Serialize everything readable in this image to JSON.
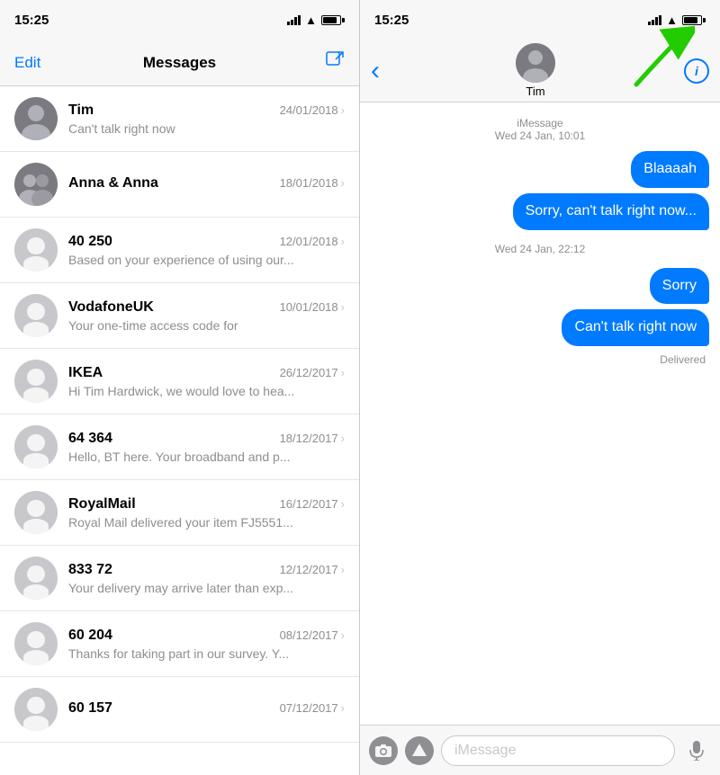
{
  "left": {
    "status_bar": {
      "time": "15:25"
    },
    "nav": {
      "edit": "Edit",
      "title": "Messages",
      "compose_icon": "✏"
    },
    "conversations": [
      {
        "id": 1,
        "name": "Tim",
        "date": "24/01/2018",
        "preview": "Can't talk right now",
        "avatar_type": "tim"
      },
      {
        "id": 2,
        "name": "Anna & Anna",
        "date": "18/01/2018",
        "preview": "...",
        "avatar_type": "group"
      },
      {
        "id": 3,
        "name": "40 250",
        "date": "12/01/2018",
        "preview": "Based on your experience of using our...",
        "avatar_type": "generic"
      },
      {
        "id": 4,
        "name": "VodafoneUK",
        "date": "10/01/2018",
        "preview": "Your one-time access code for",
        "avatar_type": "generic"
      },
      {
        "id": 5,
        "name": "IKEA",
        "date": "26/12/2017",
        "preview": "Hi Tim Hardwick, we would love to hea...",
        "avatar_type": "generic"
      },
      {
        "id": 6,
        "name": "64 364",
        "date": "18/12/2017",
        "preview": "Hello, BT here. Your broadband and p...",
        "avatar_type": "generic"
      },
      {
        "id": 7,
        "name": "RoyalMail",
        "date": "16/12/2017",
        "preview": "Royal Mail delivered your item FJ5551...",
        "avatar_type": "generic"
      },
      {
        "id": 8,
        "name": "833 72",
        "date": "12/12/2017",
        "preview": "Your delivery may arrive later than exp...",
        "avatar_type": "generic"
      },
      {
        "id": 9,
        "name": "60 204",
        "date": "08/12/2017",
        "preview": "Thanks for taking part in our survey. Y...",
        "avatar_type": "generic"
      },
      {
        "id": 10,
        "name": "60 157",
        "date": "07/12/2017",
        "preview": "",
        "avatar_type": "generic"
      }
    ]
  },
  "right": {
    "status_bar": {
      "time": "15:25"
    },
    "contact_name": "Tim",
    "imessage_label": "iMessage",
    "timestamp_first": "Wed 24 Jan, 10:01",
    "timestamp_second": "Wed 24 Jan, 22:12",
    "messages": [
      {
        "id": 1,
        "text": "Blaaaah",
        "type": "outgoing"
      },
      {
        "id": 2,
        "text": "Sorry, can't talk right now...",
        "type": "outgoing"
      },
      {
        "id": 3,
        "text": "Sorry",
        "type": "outgoing"
      },
      {
        "id": 4,
        "text": "Can't talk right now",
        "type": "outgoing"
      }
    ],
    "delivered_label": "Delivered",
    "input_placeholder": "iMessage",
    "camera_icon": "⊙",
    "appstore_icon": "A",
    "mic_icon": "🎤",
    "info_icon": "i",
    "back_icon": "‹"
  }
}
